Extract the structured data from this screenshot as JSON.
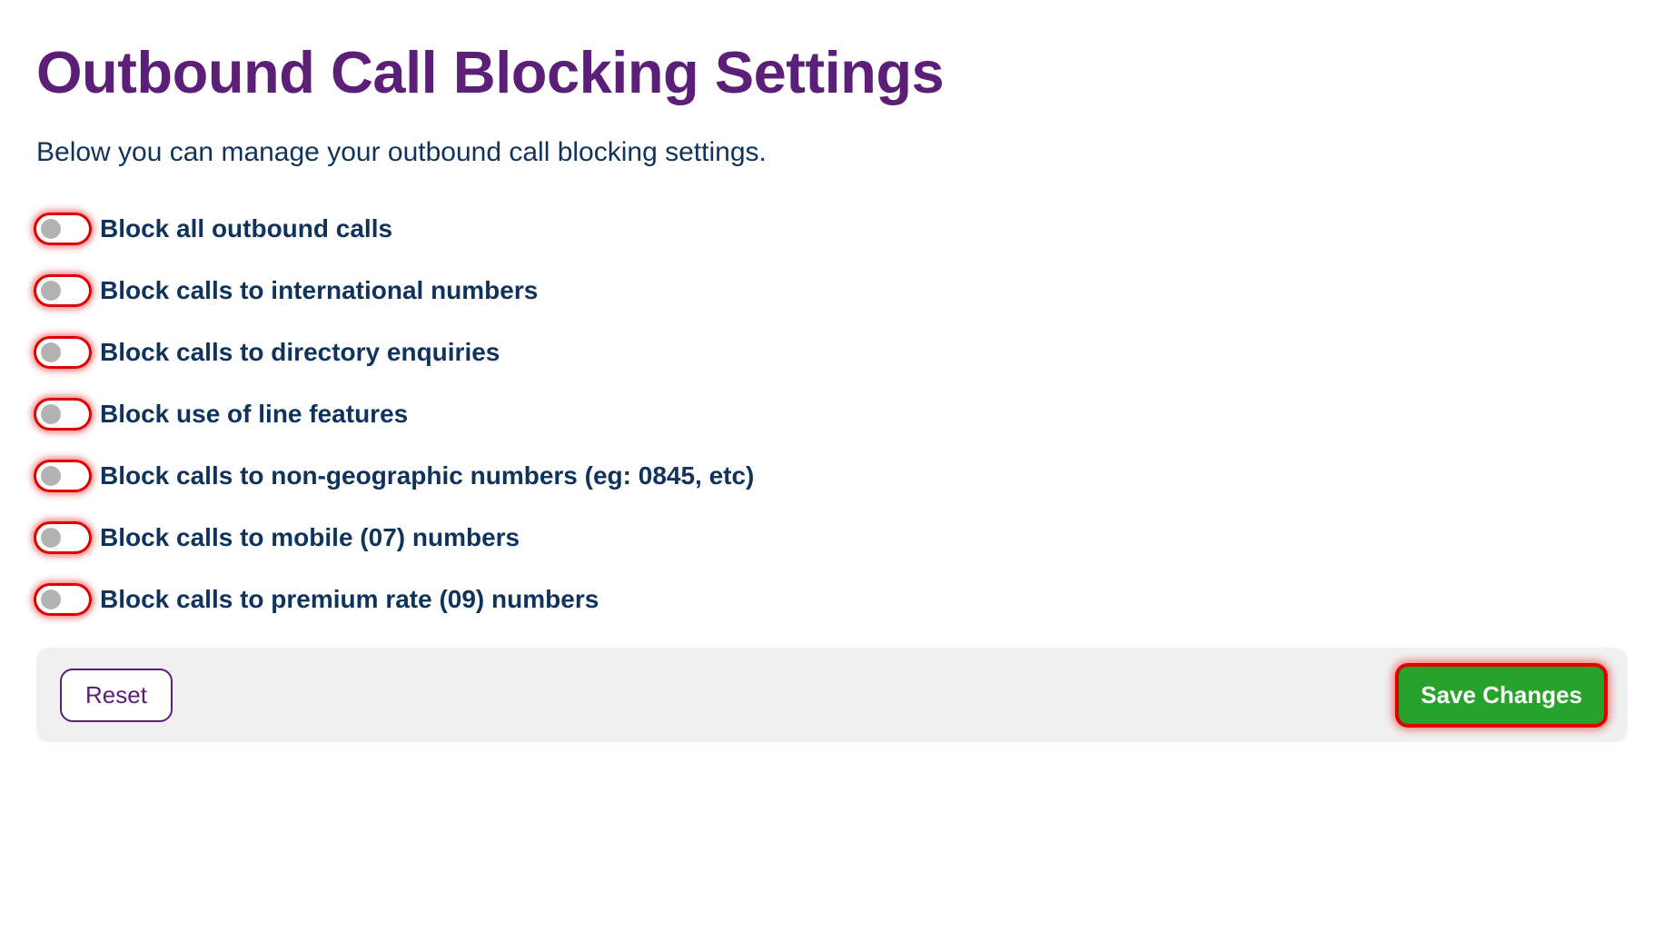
{
  "page": {
    "title": "Outbound Call Blocking Settings",
    "subtitle": "Below you can manage your outbound call blocking settings."
  },
  "options": [
    {
      "id": "block-all-outbound",
      "label": "Block all outbound calls"
    },
    {
      "id": "block-international",
      "label": "Block calls to international numbers"
    },
    {
      "id": "block-directory-enquiries",
      "label": "Block calls to directory enquiries"
    },
    {
      "id": "block-line-features",
      "label": "Block use of line features"
    },
    {
      "id": "block-nongeographic",
      "label": "Block calls to non-geographic numbers (eg: 0845, etc)"
    },
    {
      "id": "block-mobile",
      "label": "Block calls to mobile (07) numbers"
    },
    {
      "id": "block-premium",
      "label": "Block calls to premium rate (09) numbers"
    }
  ],
  "footer": {
    "reset_label": "Reset",
    "save_label": "Save Changes"
  },
  "colors": {
    "heading": "#5b1f78",
    "body_text": "#10335b",
    "highlight_ring": "#e10000",
    "save_bg": "#27a32b",
    "footer_bg": "#f0f0f0"
  }
}
